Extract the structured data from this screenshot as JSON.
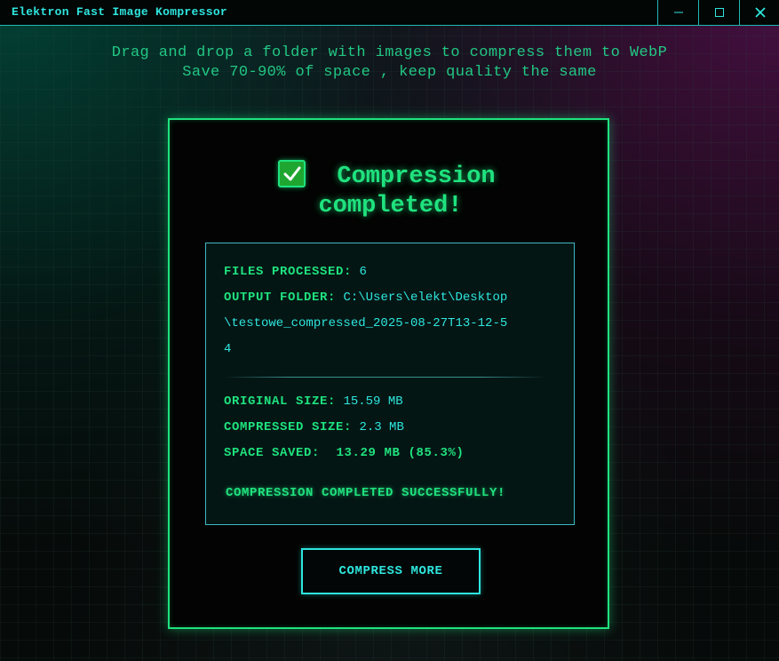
{
  "window": {
    "title": "Elektron Fast Image Kompressor",
    "buttons": {
      "minimize_icon": "minimize-icon",
      "maximize_icon": "maximize-icon",
      "close_icon": "close-icon"
    }
  },
  "header": {
    "line1": "Drag and drop a folder with images to compress them to WebP",
    "line2": "Save 70-90% of space , keep quality the same"
  },
  "result": {
    "icon": "check-box-icon",
    "headline_line1": "Compression",
    "headline_line2": "completed!",
    "stats": {
      "files_label": "FILES PROCESSED:",
      "files_value": "6",
      "output_label": "OUTPUT FOLDER:",
      "output_value_1": "C:\\Users\\elekt\\Desktop",
      "output_value_2": "\\testowe_compressed_2025-08-27T13-12-5",
      "output_value_3": "4",
      "original_label": "ORIGINAL SIZE:",
      "original_value": "15.59 MB",
      "compressed_label": "COMPRESSED SIZE:",
      "compressed_value": "2.3 MB",
      "saved_label": "SPACE SAVED:",
      "saved_value": "13.29 MB (85.3%)",
      "success_message": "COMPRESSION COMPLETED SUCCESSFULLY!"
    },
    "compress_more_label": "COMPRESS MORE"
  },
  "colors": {
    "accent_green": "#1fe27e",
    "accent_cyan": "#2ee6de",
    "background": "#060a09"
  }
}
